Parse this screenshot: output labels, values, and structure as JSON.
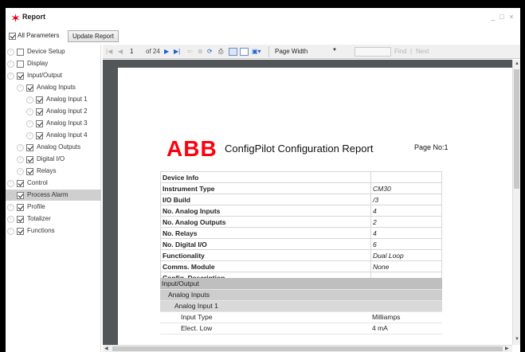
{
  "window": {
    "title": "Report",
    "controls": {
      "minimize": "_",
      "maximize": "□",
      "close": "×"
    }
  },
  "top": {
    "all_parameters_label": "All Parameters",
    "update_button": "Update Report"
  },
  "tree": {
    "items": [
      {
        "label": "Device Setup",
        "checked": false
      },
      {
        "label": "Display",
        "checked": false
      },
      {
        "label": "Input/Output",
        "checked": true
      },
      {
        "label": "Analog Inputs",
        "checked": true
      },
      {
        "label": "Analog Input 1",
        "checked": true
      },
      {
        "label": "Analog Input 2",
        "checked": true
      },
      {
        "label": "Analog Input 3",
        "checked": true
      },
      {
        "label": "Analog Input 4",
        "checked": true
      },
      {
        "label": "Analog Outputs",
        "checked": true
      },
      {
        "label": "Digital I/O",
        "checked": true
      },
      {
        "label": "Relays",
        "checked": true
      },
      {
        "label": "Control",
        "checked": true
      },
      {
        "label": "Process Alarm",
        "checked": true,
        "selected": true
      },
      {
        "label": "Profile",
        "checked": true
      },
      {
        "label": "Totalizer",
        "checked": true
      },
      {
        "label": "Functions",
        "checked": true
      }
    ]
  },
  "toolbar": {
    "page_current": "1",
    "page_of": "of 24",
    "zoom": "Page Width",
    "find_label": "Find",
    "separator": "|",
    "next_label": "Next",
    "icons": [
      "first-page-icon",
      "prev-page-icon",
      "next-page-icon",
      "last-page-icon",
      "back-icon",
      "stop-icon",
      "refresh-icon",
      "print-icon",
      "print-layout-icon",
      "page-setup-icon",
      "export-icon"
    ]
  },
  "report": {
    "logo_text": "ABB",
    "title": "ConfigPilot Configuration Report",
    "page_no": "Page No:1",
    "device_info": [
      {
        "key": "Device Info",
        "value": ""
      },
      {
        "key": "Instrument Type",
        "value": "CM30"
      },
      {
        "key": "I/O Build",
        "value": "/3"
      },
      {
        "key": "No. Analog Inputs",
        "value": "4"
      },
      {
        "key": "No. Analog Outputs",
        "value": "2"
      },
      {
        "key": "No. Relays",
        "value": "4"
      },
      {
        "key": "No. Digital I/O",
        "value": "6"
      },
      {
        "key": "Functionality",
        "value": "Dual Loop"
      },
      {
        "key": "Comms. Module",
        "value": "None"
      },
      {
        "key": "Config. Description",
        "value": ""
      }
    ],
    "section": [
      {
        "label": "Input/Output",
        "value": ""
      },
      {
        "label": "Analog Inputs",
        "value": ""
      },
      {
        "label": "Analog Input 1",
        "value": ""
      },
      {
        "label": "Input Type",
        "value": "Milliamps"
      },
      {
        "label": "Elect. Low",
        "value": "4 mA"
      }
    ]
  },
  "colors": {
    "brand_red": "#ff000f",
    "canvas": "#525659",
    "selected_row": "#cfcfcf"
  }
}
